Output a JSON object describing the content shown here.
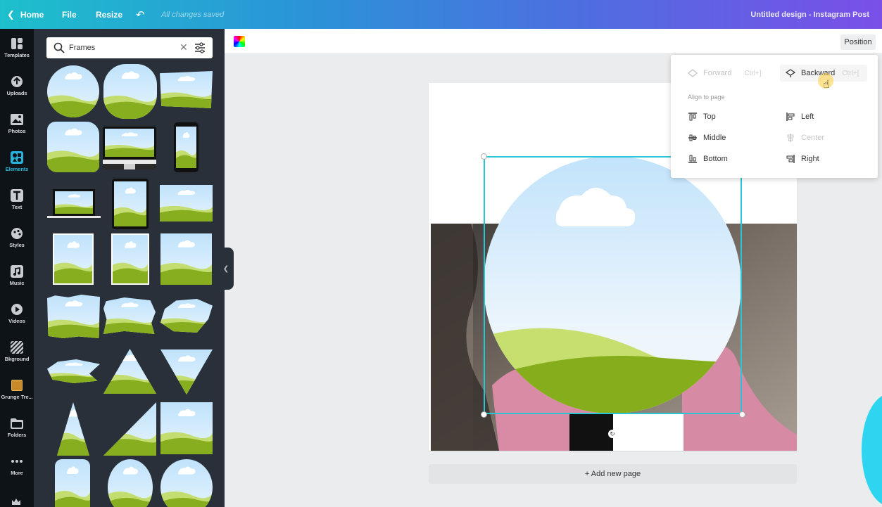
{
  "topbar": {
    "home": "Home",
    "file": "File",
    "resize": "Resize",
    "saved": "All changes saved",
    "title": "Untitled design - Instagram Post"
  },
  "rail": [
    {
      "label": "Templates",
      "icon": "templates-icon"
    },
    {
      "label": "Uploads",
      "icon": "uploads-icon"
    },
    {
      "label": "Photos",
      "icon": "photos-icon"
    },
    {
      "label": "Elements",
      "icon": "elements-icon",
      "active": true
    },
    {
      "label": "Text",
      "icon": "text-icon"
    },
    {
      "label": "Styles",
      "icon": "styles-icon"
    },
    {
      "label": "Music",
      "icon": "music-icon"
    },
    {
      "label": "Videos",
      "icon": "videos-icon"
    },
    {
      "label": "Bkground",
      "icon": "background-icon"
    },
    {
      "label": "Grunge Tre...",
      "icon": "folder-thumb-icon"
    },
    {
      "label": "Folders",
      "icon": "folders-icon"
    },
    {
      "label": "More",
      "icon": "more-icon"
    }
  ],
  "search": {
    "value": "Frames",
    "placeholder": "Search"
  },
  "canvas": {
    "position_button": "Position",
    "add_page": "+ Add new page"
  },
  "position_menu": {
    "forward": "Forward",
    "forward_kbd": "Ctrl+]",
    "backward": "Backward",
    "backward_kbd": "Ctrl+[",
    "group_label": "Align to page",
    "top": "Top",
    "left": "Left",
    "middle": "Middle",
    "center": "Center",
    "bottom": "Bottom",
    "right": "Right"
  },
  "colors": {
    "accent": "#27c5d6",
    "rail_bg": "#0e1318",
    "panel_bg": "#293039",
    "sky": "#cfe9fb",
    "grass": "#8ab31d"
  }
}
